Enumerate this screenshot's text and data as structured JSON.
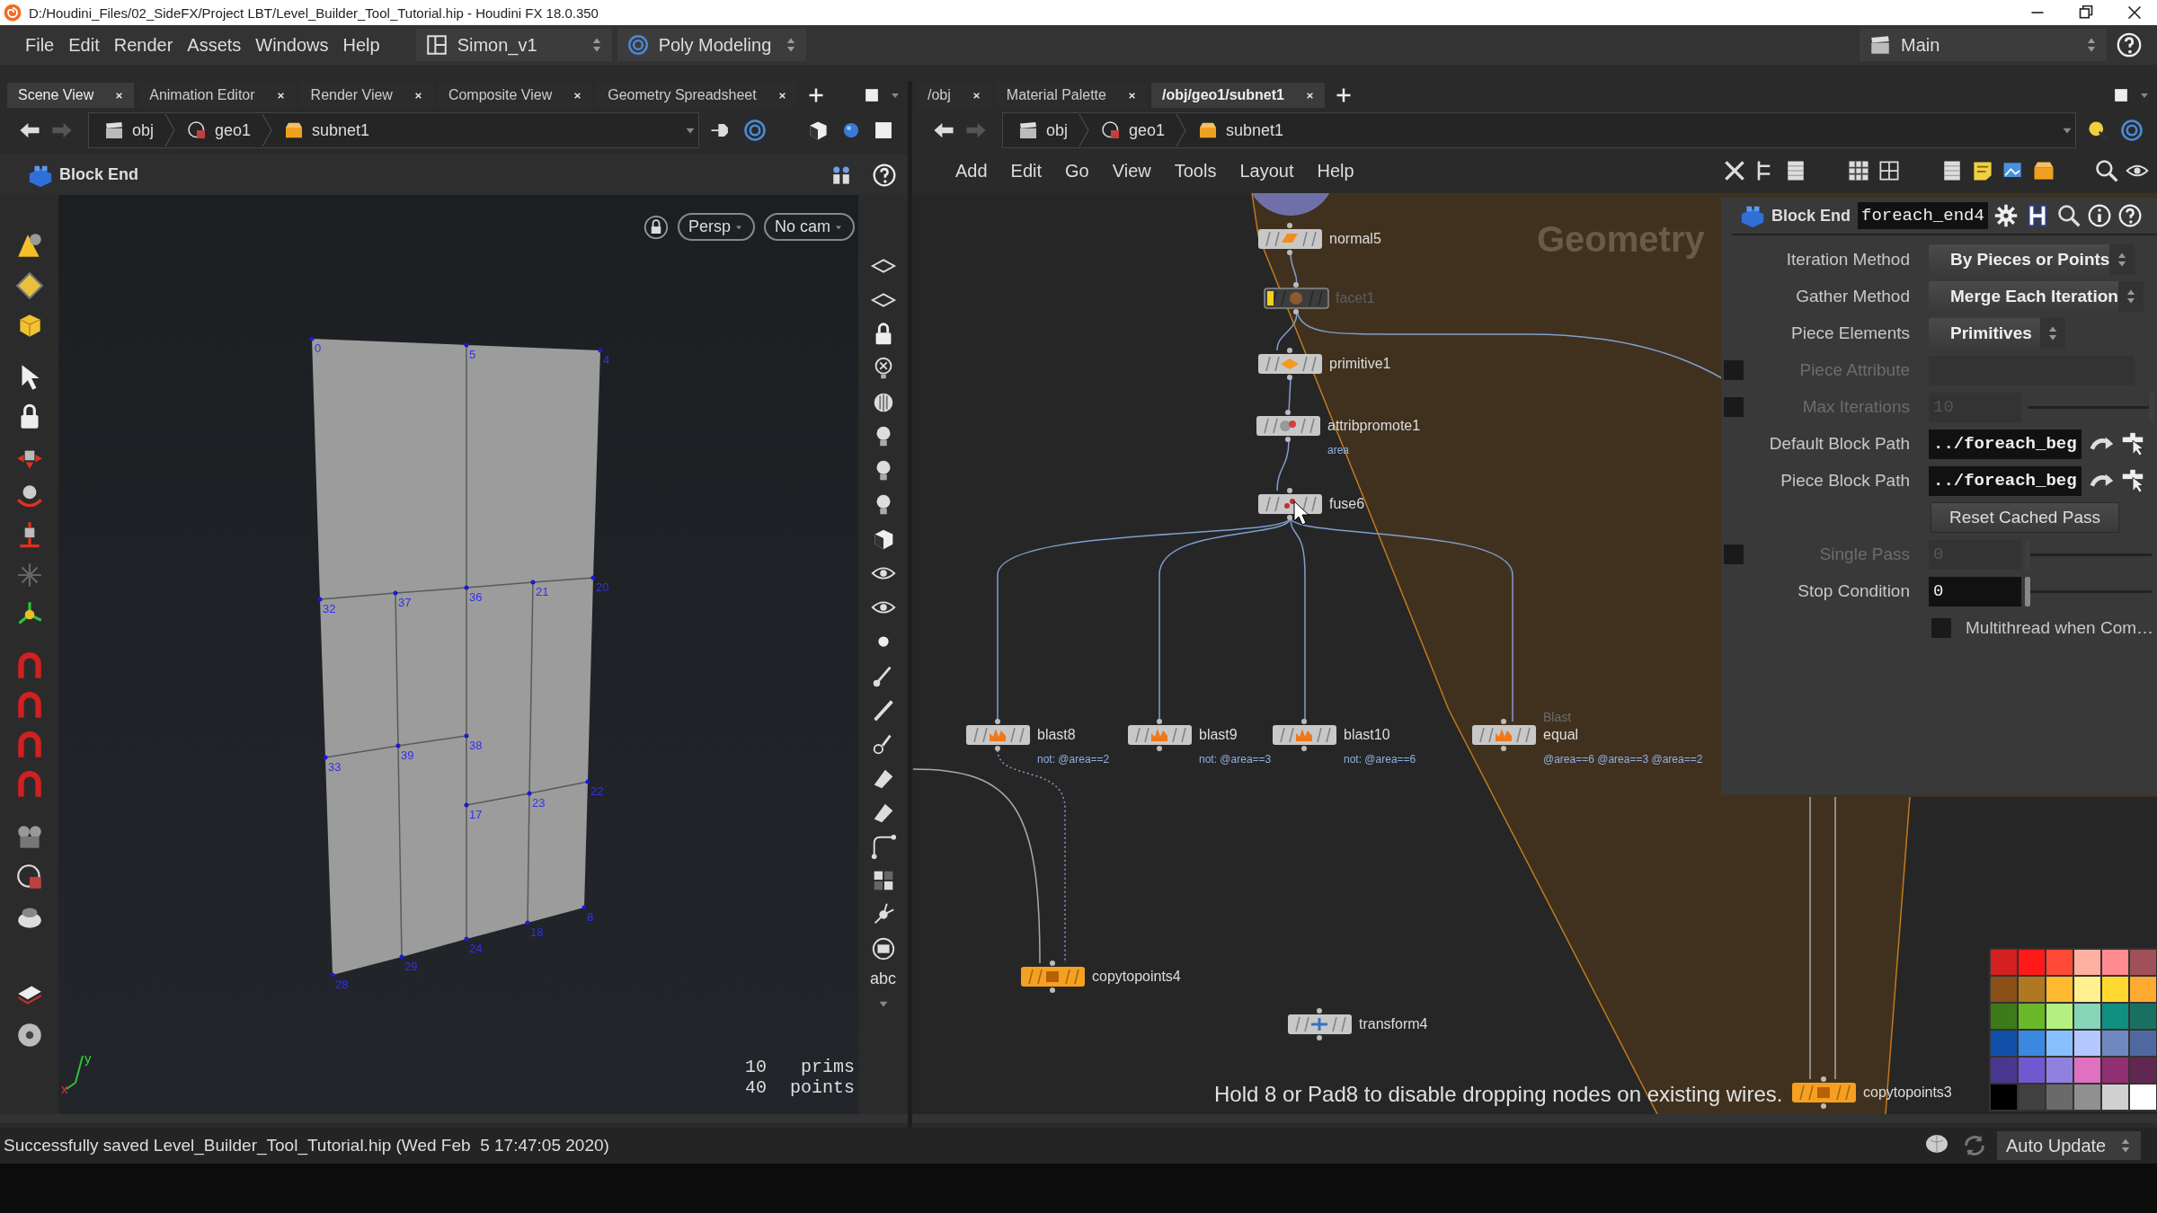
{
  "window": {
    "title": "D:/Houdini_Files/02_SideFX/Project LBT/Level_Builder_Tool_Tutorial.hip - Houdini FX 18.0.350"
  },
  "menu": [
    "File",
    "Edit",
    "Render",
    "Assets",
    "Windows",
    "Help"
  ],
  "desktop": "Simon_v1",
  "shelf_set": "Poly Modeling",
  "workspace": "Main",
  "left_pane": {
    "tabs": [
      {
        "label": "Scene View",
        "selected": true
      },
      {
        "label": "Animation Editor",
        "selected": false
      },
      {
        "label": "Render View",
        "selected": false
      },
      {
        "label": "Composite View",
        "selected": false
      },
      {
        "label": "Geometry Spreadsheet",
        "selected": false
      }
    ],
    "path": [
      "obj",
      "geo1",
      "subnet1"
    ],
    "operator": "Block End",
    "viewport": {
      "camera_view": "Persp",
      "camera": "No cam",
      "toolbar_text": "abc",
      "axis_labels": [
        "x",
        "y"
      ],
      "point_labels": [
        "0",
        "5",
        "4",
        "32",
        "37",
        "36",
        "21",
        "20",
        "33",
        "39",
        "38",
        "17",
        "23",
        "22",
        "28",
        "29",
        "24",
        "18",
        "8"
      ],
      "stats": [
        {
          "value": "10",
          "unit": "prims"
        },
        {
          "value": "40",
          "unit": "points"
        }
      ]
    }
  },
  "right_pane": {
    "tabs": [
      {
        "label": "/obj",
        "selected": false
      },
      {
        "label": "Material Palette",
        "selected": false
      },
      {
        "label": "/obj/geo1/subnet1",
        "selected": true
      }
    ],
    "path": [
      "obj",
      "geo1",
      "subnet1"
    ],
    "menu": [
      "Add",
      "Edit",
      "Go",
      "View",
      "Tools",
      "Layout",
      "Help"
    ],
    "network": {
      "box_label": "Geometry",
      "hint": "Hold 8 or Pad8 to disable dropping nodes on existing wires.",
      "nodes": [
        {
          "name": "normal5",
          "kind": "normal",
          "color": "#c8c8c8",
          "bypassed": false
        },
        {
          "name": "facet1",
          "kind": "facet",
          "color": "#3c3c3c",
          "bypassed": true
        },
        {
          "name": "primitive1",
          "kind": "primitive",
          "color": "#c8c8c8",
          "bypassed": false
        },
        {
          "name": "attribpromote1",
          "kind": "attribpromote",
          "color": "#c8c8c8",
          "bypassed": false,
          "comment": "area"
        },
        {
          "name": "fuse6",
          "kind": "fuse",
          "color": "#c8c8c8",
          "bypassed": false
        },
        {
          "name": "blast8",
          "kind": "blast",
          "color": "#c8c8c8",
          "bypassed": false,
          "comment": "not: @area==2"
        },
        {
          "name": "blast9",
          "kind": "blast",
          "color": "#c8c8c8",
          "bypassed": false,
          "comment": "not: @area==3"
        },
        {
          "name": "blast10",
          "kind": "blast",
          "color": "#c8c8c8",
          "bypassed": false,
          "comment": "not: @area==6"
        },
        {
          "name": "equal",
          "kind": "blast",
          "color": "#c8c8c8",
          "bypassed": false,
          "type": "Blast",
          "comment": "@area==6 @area==3 @area==2"
        },
        {
          "name": "copytopoints4",
          "kind": "copytopoints",
          "color": "#f5a020",
          "bypassed": false
        },
        {
          "name": "transform4",
          "kind": "transform",
          "color": "#c8c8c8",
          "bypassed": false
        },
        {
          "name": "copytopoints3",
          "kind": "copytopoints",
          "color": "#f5a020",
          "bypassed": false
        }
      ],
      "palette": [
        {
          "color": "#d42020"
        },
        {
          "color": "#ff1a1a"
        },
        {
          "color": "#ff4a38"
        },
        {
          "color": "#ffb0a0"
        },
        {
          "color": "#ff8a90"
        },
        {
          "color": "#a05058"
        },
        {
          "color": "#8a5018"
        },
        {
          "color": "#b07820"
        },
        {
          "color": "#ffba30"
        },
        {
          "color": "#fff090"
        },
        {
          "color": "#ffd830"
        },
        {
          "color": "#ffaa30"
        },
        {
          "color": "#3e7a18"
        },
        {
          "color": "#6ab82a"
        },
        {
          "color": "#b4f080"
        },
        {
          "color": "#88d4b8"
        },
        {
          "color": "#109080"
        },
        {
          "color": "#1a7060"
        },
        {
          "color": "#1050a8"
        },
        {
          "color": "#3a88e0"
        },
        {
          "color": "#88c0ff"
        },
        {
          "color": "#b4c8ff"
        },
        {
          "color": "#7088c0"
        },
        {
          "color": "#5068a0"
        },
        {
          "color": "#4a3890"
        },
        {
          "color": "#7058d0"
        },
        {
          "color": "#9080e0"
        },
        {
          "color": "#e070c0"
        },
        {
          "color": "#903070"
        },
        {
          "color": "#602850"
        },
        {
          "color": "#000000"
        },
        {
          "color": "#404040"
        },
        {
          "color": "#6a6a6a"
        },
        {
          "color": "#909090"
        },
        {
          "color": "#d0d0d0"
        },
        {
          "color": "#ffffff"
        }
      ]
    },
    "parameters": {
      "operator": "Block End",
      "node_name": "foreach_end4",
      "items": [
        {
          "kind": "menu_wide",
          "label": "Iteration Method",
          "value": "By Pieces or Points",
          "disabled": false
        },
        {
          "kind": "menu_wide",
          "label": "Gather Method",
          "value": "Merge Each Iteration",
          "disabled": false
        },
        {
          "kind": "menu",
          "label": "Piece Elements",
          "value": "Primitives",
          "disabled": false
        },
        {
          "kind": "string",
          "label": "Piece Attribute",
          "disabled": true,
          "toggle_checked": false
        },
        {
          "kind": "int",
          "label": "Max Iterations",
          "value": "10",
          "level": 1,
          "disabled": true,
          "toggle_checked": false
        },
        {
          "kind": "path",
          "label": "Default Block Path",
          "value": "../foreach_beg",
          "disabled": false
        },
        {
          "kind": "path",
          "label": "Piece Block Path",
          "value": "../foreach_beg",
          "disabled": false
        },
        {
          "kind": "button",
          "label": "Reset Cached Pass",
          "disabled": false
        },
        {
          "kind": "int",
          "label": "Single Pass",
          "value": "0",
          "level": 0,
          "disabled": true,
          "toggle_checked": false
        },
        {
          "kind": "int",
          "label": "Stop Condition",
          "value": "0",
          "level": 0,
          "disabled": false
        },
        {
          "kind": "checkbox",
          "label": "Multithread when Com…",
          "checked": false,
          "disabled": false
        }
      ]
    }
  },
  "status": {
    "message": "Successfully saved Level_Builder_Tool_Tutorial.hip (Wed Feb  5 17:47:05 2020)",
    "update_mode": "Auto Update"
  }
}
